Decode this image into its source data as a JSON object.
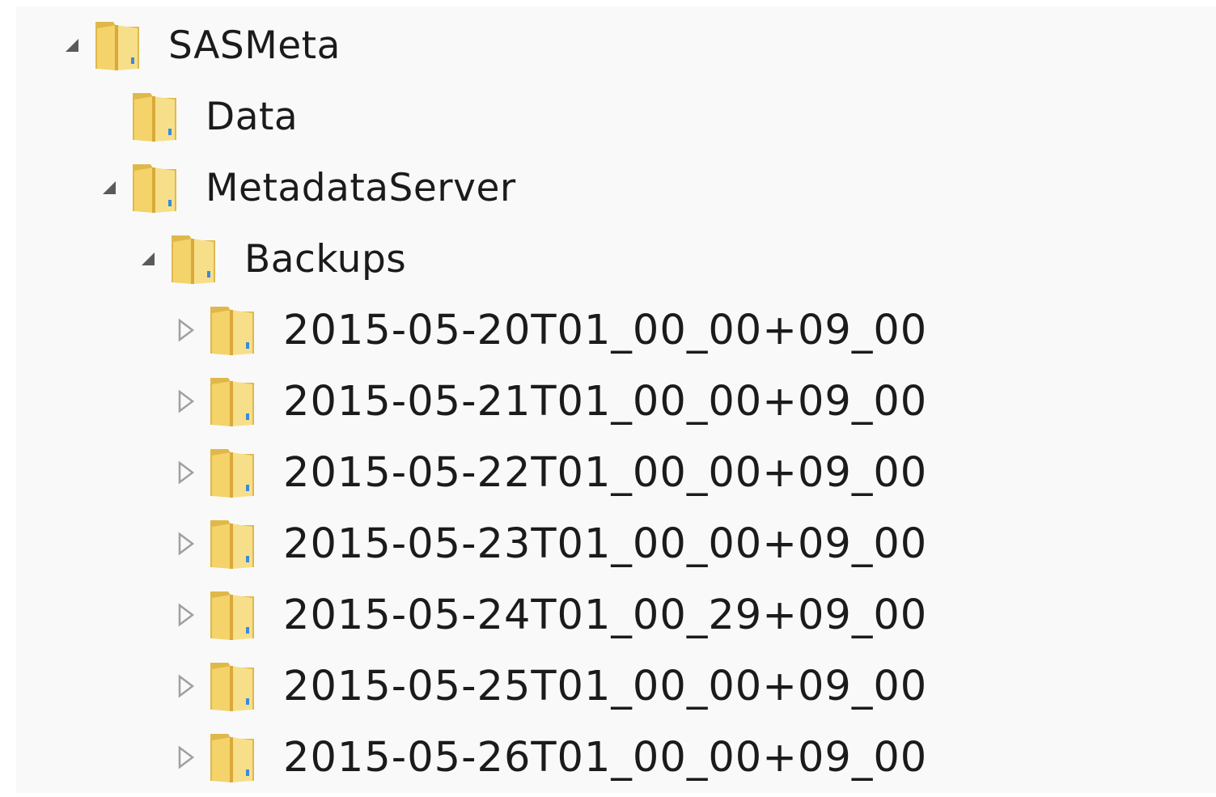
{
  "tree": {
    "root": {
      "label": "SASMeta",
      "expander": "expanded-arrow-icon",
      "icon": "folder-icon"
    },
    "data_folder": {
      "label": "Data",
      "icon": "folder-icon"
    },
    "metadata_server": {
      "label": "MetadataServer",
      "expander": "expanded-arrow-icon",
      "icon": "folder-icon"
    },
    "backups": {
      "label": "Backups",
      "expander": "expanded-arrow-icon",
      "icon": "folder-icon"
    },
    "backup_items": [
      {
        "label": "2015-05-20T01_00_00+09_00",
        "expander": "collapsed-arrow-icon"
      },
      {
        "label": "2015-05-21T01_00_00+09_00",
        "expander": "collapsed-arrow-icon"
      },
      {
        "label": "2015-05-22T01_00_00+09_00",
        "expander": "collapsed-arrow-icon"
      },
      {
        "label": "2015-05-23T01_00_00+09_00",
        "expander": "collapsed-arrow-icon"
      },
      {
        "label": "2015-05-24T01_00_29+09_00",
        "expander": "collapsed-arrow-icon"
      },
      {
        "label": "2015-05-25T01_00_00+09_00",
        "expander": "collapsed-arrow-icon"
      },
      {
        "label": "2015-05-26T01_00_00+09_00",
        "expander": "collapsed-arrow-icon"
      }
    ]
  },
  "colors": {
    "folder_front": "#f3d36a",
    "folder_back": "#e0b84a",
    "expander_collapsed": "#a0a0a0",
    "expander_expanded": "#5a5a5a",
    "text": "#1b1b1b"
  }
}
